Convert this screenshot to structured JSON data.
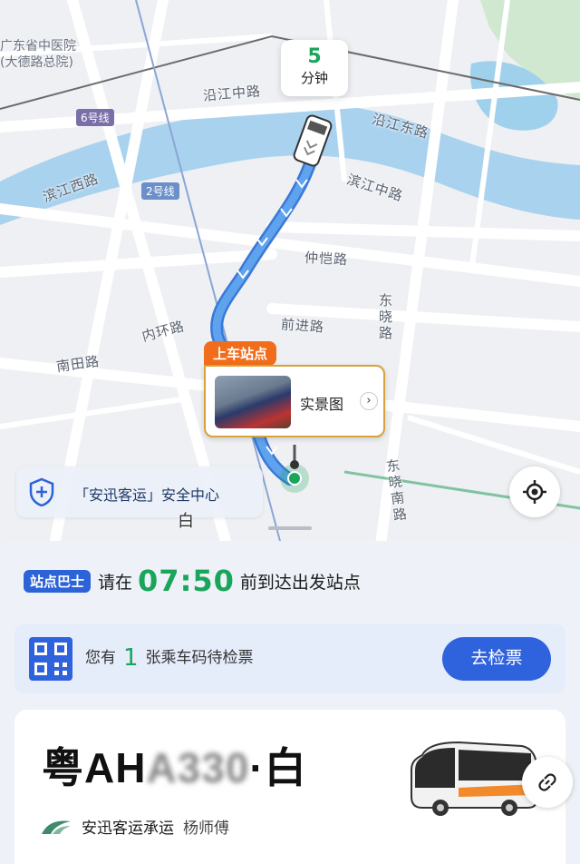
{
  "map": {
    "eta": {
      "value": "5",
      "unit": "分钟"
    },
    "road_labels": {
      "yanjiang_middle": "沿江中路",
      "yanjiang_east": "沿江东路",
      "binjiang_west": "滨江西路",
      "binjiang_middle": "滨江中路",
      "zhongkai": "仲恺路",
      "qianjin": "前进路",
      "neihuan": "内环路",
      "nantian": "南田路",
      "dongxiao": "东晓路",
      "dongxiao_south": "东晓南路",
      "bai": "白"
    },
    "poi": {
      "hospital_line1": "广东省中医院",
      "hospital_line2": "(大德路总院)"
    },
    "metro": {
      "line6": "6号线",
      "line2": "2号线"
    },
    "pickup": {
      "tag": "上车站点",
      "photo_label": "实景图",
      "arrow": "›"
    },
    "safety_center": "「安迅客运」安全中心"
  },
  "sheet": {
    "notice": {
      "badge": "站点巴士",
      "prefix": "请在",
      "time": "07:50",
      "suffix": "前到达出发站点"
    },
    "ticket": {
      "prefix": "您有",
      "count": "1",
      "suffix": "张乘车码待检票",
      "button": "去检票"
    },
    "bus": {
      "plate_prefix": "粤AH",
      "plate_masked": "A330",
      "plate_suffix": "·白",
      "operator": "安迅客运承运",
      "driver": "杨师傅"
    }
  },
  "colors": {
    "accent_green": "#19a55a",
    "primary_blue": "#2f62dd",
    "pickup_orange": "#f26d1b",
    "route_blue": "#4a90e2"
  },
  "icons": [
    "shield-plus-icon",
    "locate-icon",
    "qr-code-icon",
    "link-icon",
    "bus-image",
    "operator-logo"
  ]
}
